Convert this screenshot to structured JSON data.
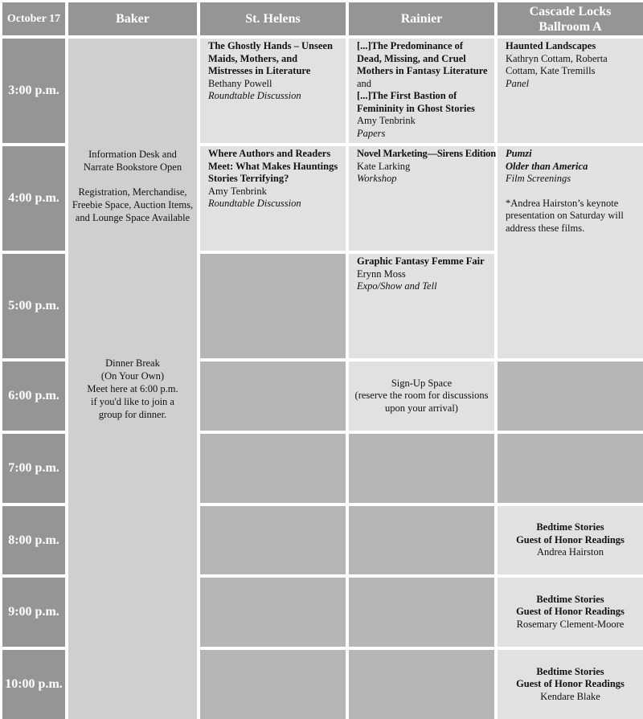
{
  "header": {
    "date": "October 17",
    "rooms": [
      "Baker",
      "St. Helens",
      "Rainier",
      "Cascade Locks Ballroom A"
    ],
    "rooms_line2": {
      "cascade_line1": "Cascade Locks",
      "cascade_line2": "Ballroom A"
    }
  },
  "times": [
    "3:00 p.m.",
    "4:00 p.m.",
    "5:00 p.m.",
    "6:00 p.m.",
    "7:00 p.m.",
    "8:00 p.m.",
    "9:00 p.m.",
    "10:00 p.m."
  ],
  "baker": {
    "info_line1": "Information Desk and",
    "info_line2": "Narrate Bookstore Open",
    "reg_line1": "Registration, Merchandise,",
    "reg_line2": "Freebie Space, Auction Items,",
    "reg_line3": "and Lounge Space Available",
    "dinner_line1": "Dinner Break",
    "dinner_line2": "(On Your Own)",
    "dinner_line3": "Meet here at 6:00 p.m.",
    "dinner_line4": "if you'd like to join a",
    "dinner_line5": "group for dinner."
  },
  "st_helens": {
    "e1": {
      "title": "The Ghostly Hands – Unseen Maids, Mothers, and Mistresses in Literature",
      "presenter": "Bethany Powell",
      "type": "Roundtable Discussion"
    },
    "e2": {
      "title": "Where Authors and Readers Meet: What Makes Hauntings Stories Terrifying?",
      "presenter": "Amy Tenbrink",
      "type": "Roundtable Discussion"
    }
  },
  "rainier": {
    "e1": {
      "title1": "[...]The Predominance of Dead, Missing, and Cruel Mothers in Fantasy Literature",
      "joiner": " and",
      "title2": "[...]The First Bastion of Femininity in Ghost Stories",
      "presenter": "Amy Tenbrink",
      "type": "Papers"
    },
    "e2": {
      "title": "Novel Marketing—Sirens Edition",
      "presenter": "Kate Larking",
      "type": "Workshop"
    },
    "e3": {
      "title": "Graphic Fantasy Femme Fair",
      "presenter": "Erynn Moss",
      "type": "Expo/Show and Tell"
    },
    "e4": {
      "line1": "Sign-Up Space",
      "line2": "(reserve the room for discussions",
      "line3": "upon your arrival)"
    }
  },
  "cascade": {
    "e1": {
      "title": "Haunted Landscapes",
      "presenter": "Kathryn Cottam, Roberta Cottam, Kate Tremills",
      "type": "Panel"
    },
    "e2": {
      "film1": "Pumzi",
      "film2": "Older than America",
      "type": "Film Screenings",
      "note": "*Andrea Hairston’s keynote presentation on Saturday will address these films."
    },
    "bedtime": [
      {
        "title": "Bedtime Stories",
        "subtitle": "Guest of Honor Readings",
        "reader": "Andrea Hairston"
      },
      {
        "title": "Bedtime Stories",
        "subtitle": "Guest of Honor Readings",
        "reader": "Rosemary Clement-Moore"
      },
      {
        "title": "Bedtime Stories",
        "subtitle": "Guest of Honor Readings",
        "reader": "Kendare Blake"
      }
    ]
  },
  "colors": {
    "header_bg": "#959595",
    "baker_bg": "#cfcfcf",
    "event_bg": "#e1e1e1",
    "empty_bg": "#b6b6b6"
  }
}
